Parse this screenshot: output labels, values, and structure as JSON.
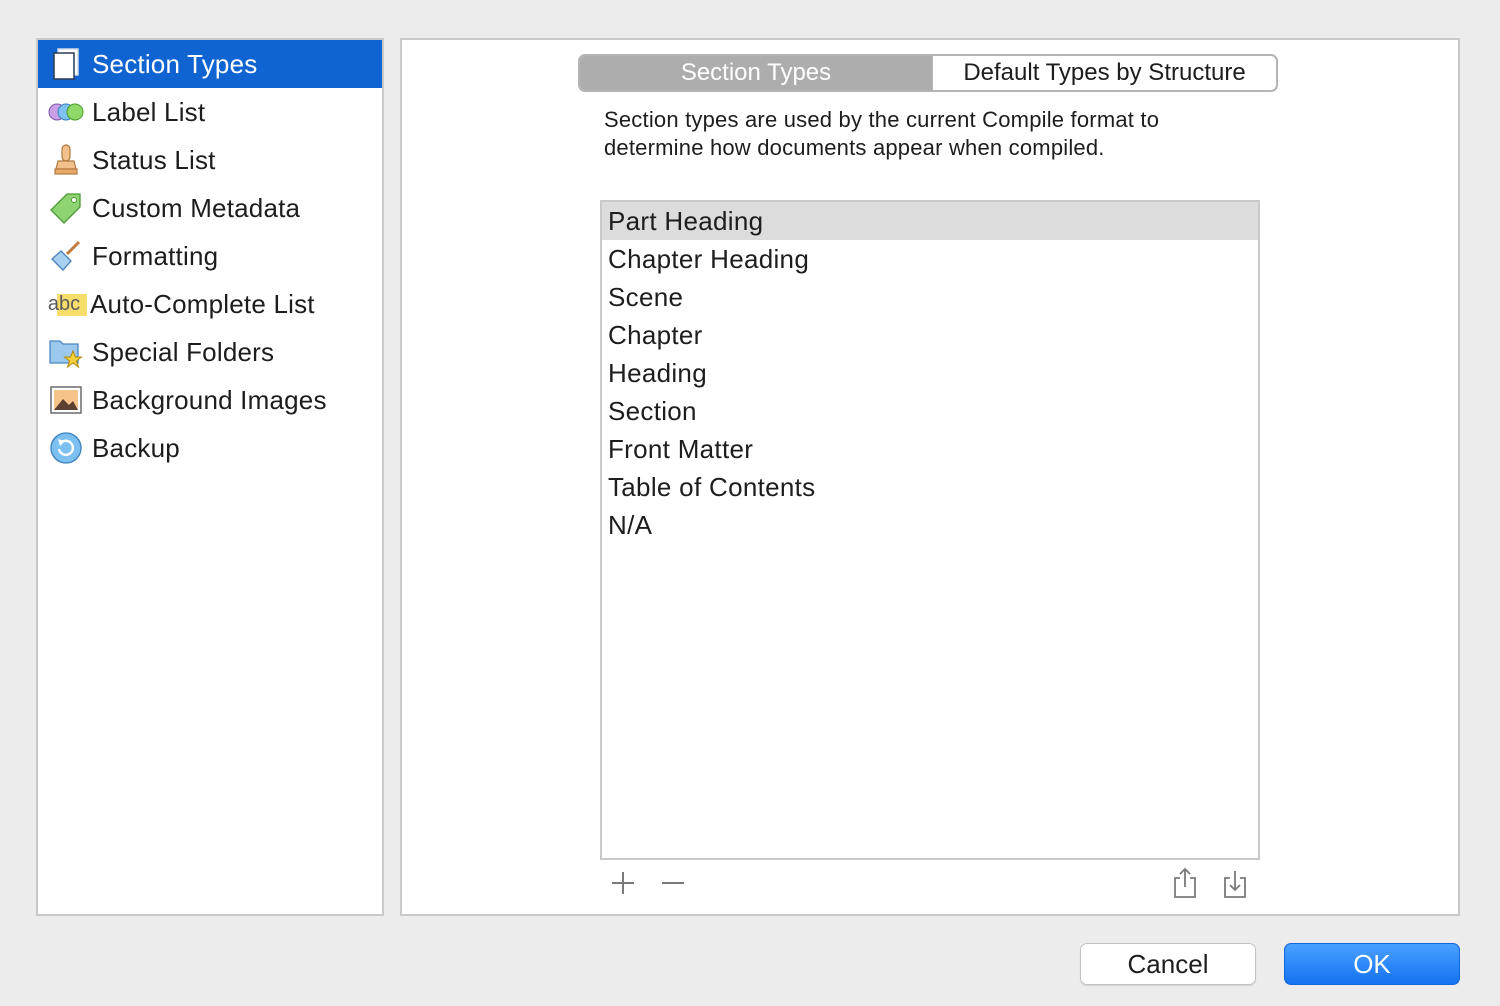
{
  "sidebar": {
    "items": [
      {
        "label": "Section Types",
        "icon": "document-icon"
      },
      {
        "label": "Label List",
        "icon": "label-circles-icon"
      },
      {
        "label": "Status List",
        "icon": "stamp-icon"
      },
      {
        "label": "Custom Metadata",
        "icon": "tag-icon"
      },
      {
        "label": "Formatting",
        "icon": "paintbrush-icon"
      },
      {
        "label": "Auto-Complete List",
        "icon": "abc-icon",
        "icon_text": "abc"
      },
      {
        "label": "Special Folders",
        "icon": "star-folder-icon"
      },
      {
        "label": "Background Images",
        "icon": "image-icon"
      },
      {
        "label": "Backup",
        "icon": "backup-icon"
      }
    ],
    "selected_index": 0
  },
  "tabs": {
    "items": [
      "Section Types",
      "Default Types by Structure"
    ],
    "active_index": 0
  },
  "description": "Section types are used by the current Compile format to determine how documents appear when compiled.",
  "section_types": {
    "items": [
      "Part Heading",
      "Chapter Heading",
      "Scene",
      "Chapter",
      "Heading",
      "Section",
      "Front Matter",
      "Table of Contents",
      "N/A"
    ],
    "selected_index": 0
  },
  "toolbar": {
    "add_icon": "plus-icon",
    "remove_icon": "minus-icon",
    "export_icon": "share-export-icon",
    "import_icon": "import-icon"
  },
  "buttons": {
    "cancel": "Cancel",
    "ok": "OK"
  },
  "colors": {
    "selection": "#0f64d2",
    "ok_button": "#1a76f2",
    "segment_active": "#adadad"
  }
}
